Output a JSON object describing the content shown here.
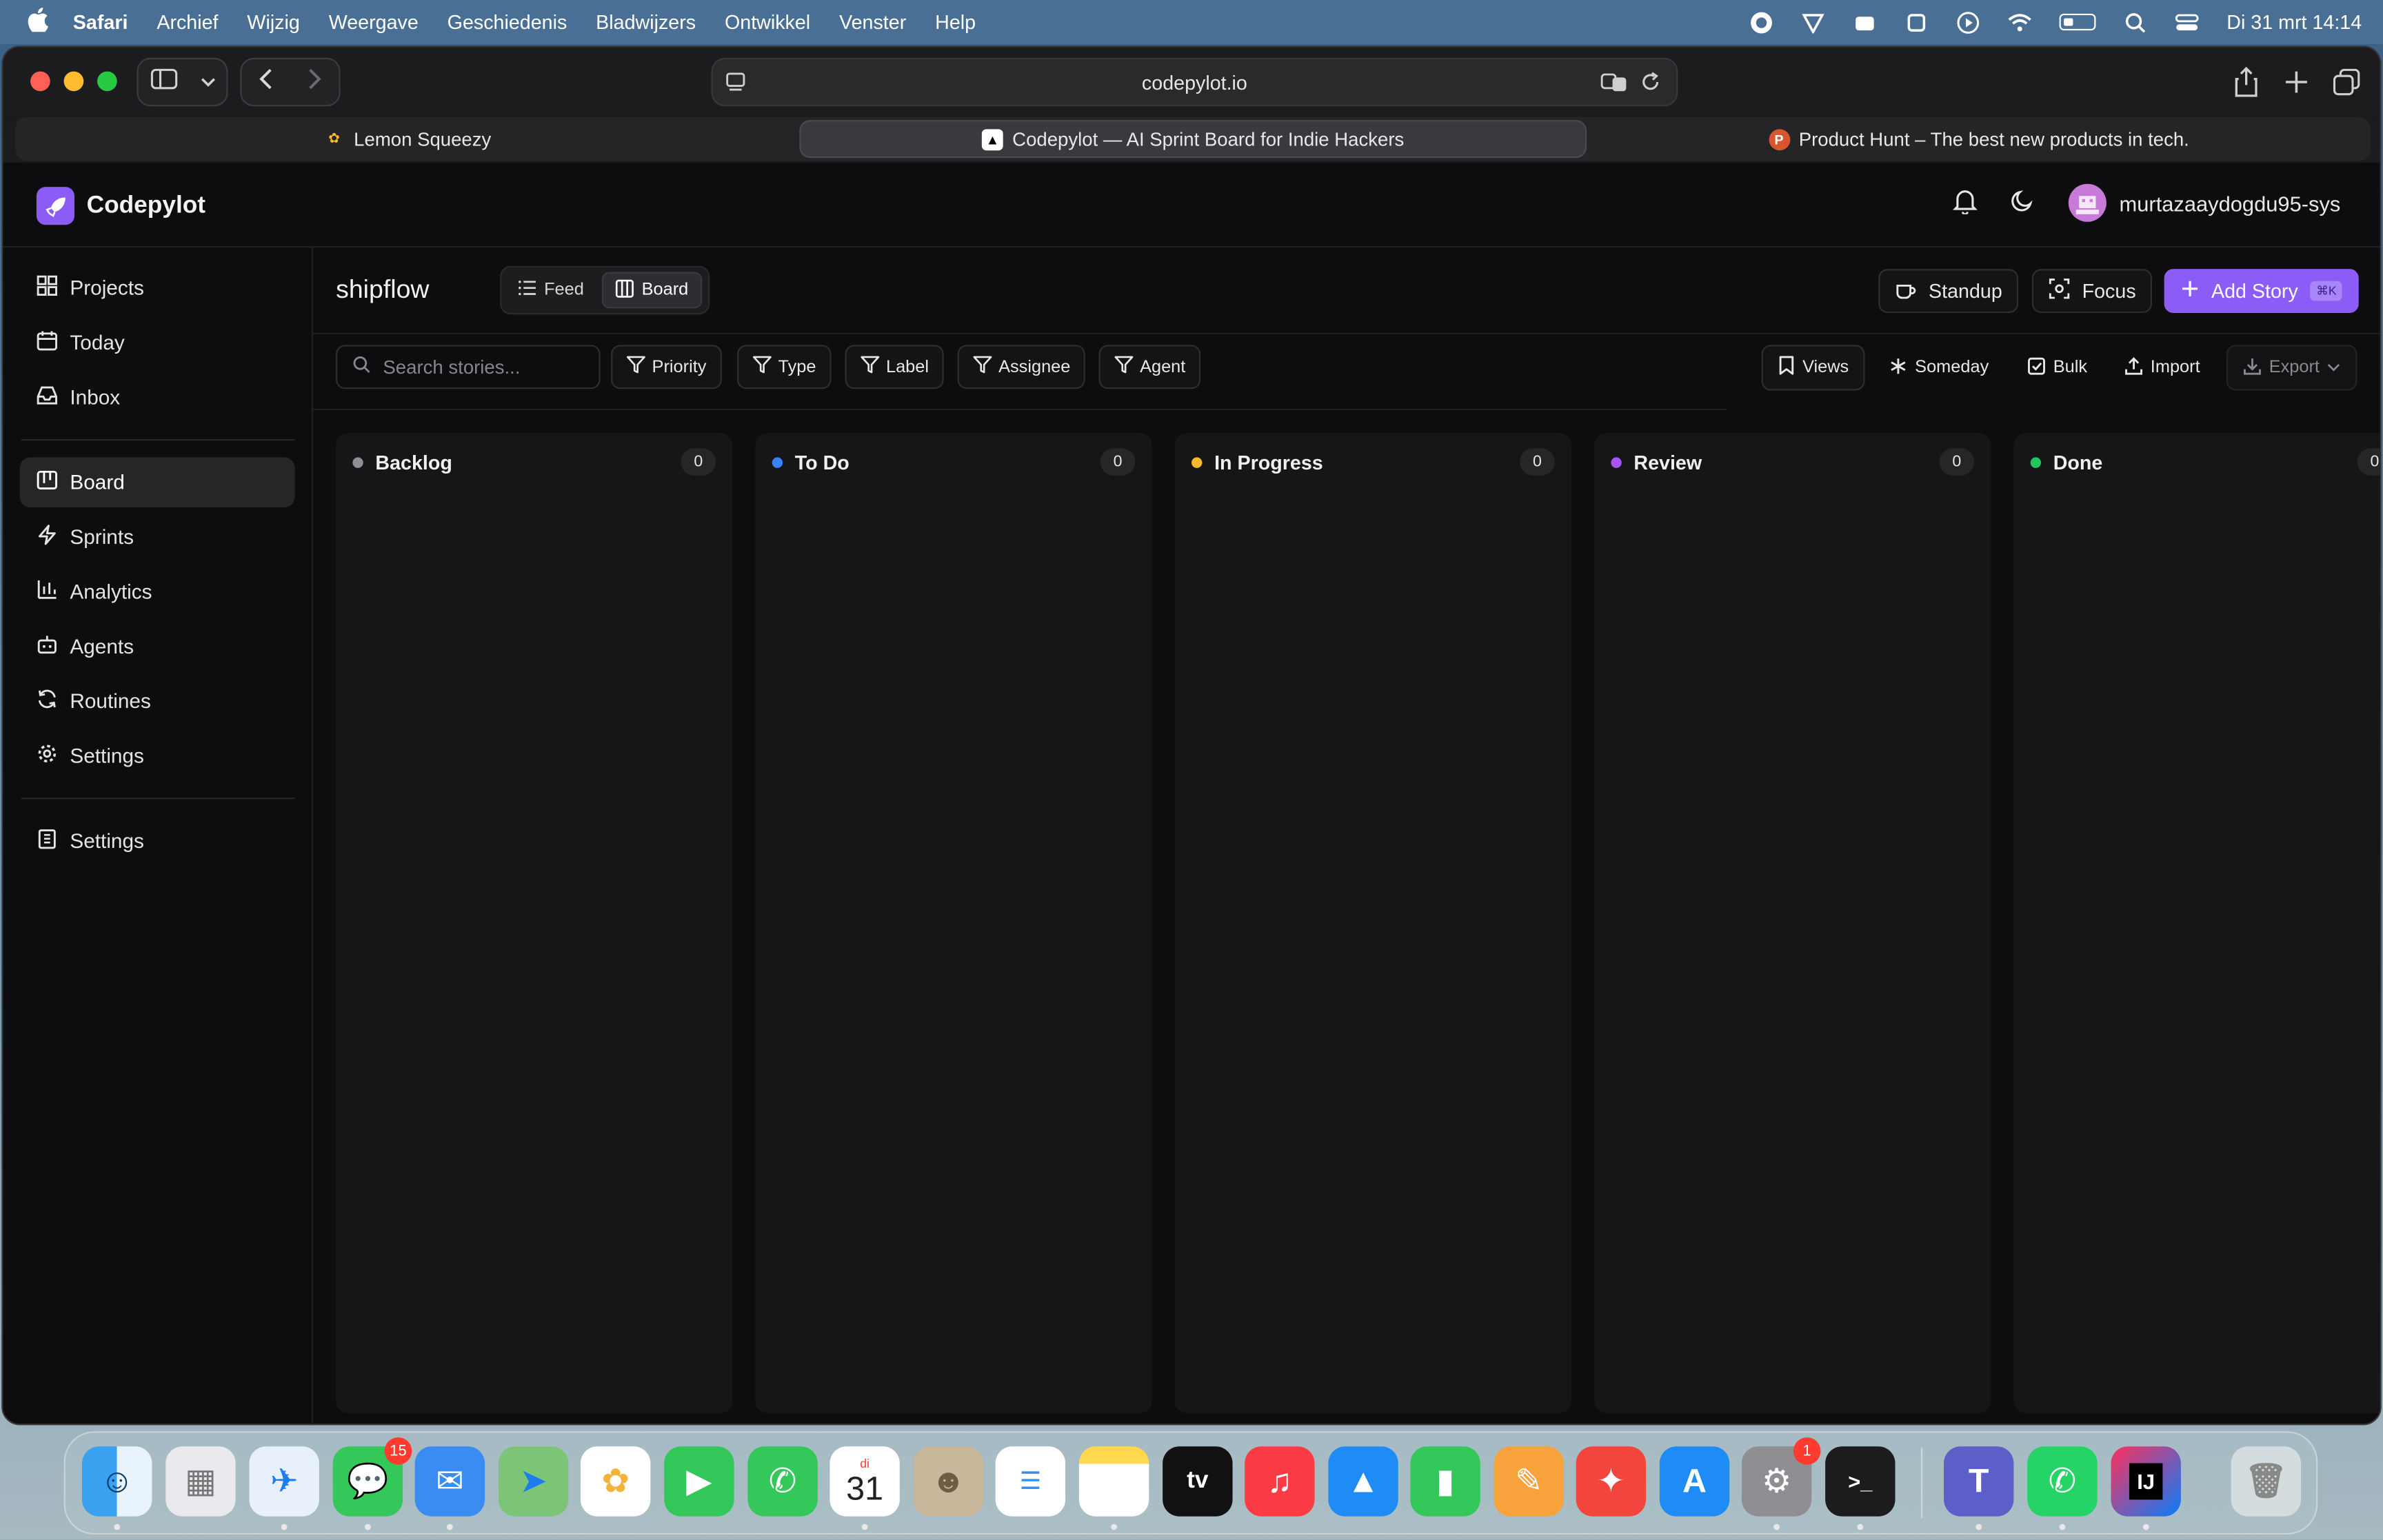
{
  "menubar": {
    "app": "Safari",
    "items": [
      "Archief",
      "Wijzig",
      "Weergave",
      "Geschiedenis",
      "Bladwijzers",
      "Ontwikkel",
      "Venster",
      "Help"
    ],
    "datetime": "Di 31 mrt  14:14"
  },
  "browser": {
    "url": "codepylot.io",
    "tabs": [
      {
        "label": "Lemon Squeezy",
        "active": false
      },
      {
        "label": "Codepylot — AI Sprint Board for Indie Hackers",
        "active": true
      },
      {
        "label": "Product Hunt – The best new products in tech.",
        "active": false
      }
    ]
  },
  "app": {
    "brand": "Codepylot",
    "username": "murtazaaydogdu95-sys",
    "sidebar": {
      "group1": [
        {
          "label": "Projects",
          "icon": "grid-icon"
        },
        {
          "label": "Today",
          "icon": "calendar-icon"
        },
        {
          "label": "Inbox",
          "icon": "inbox-icon"
        }
      ],
      "group2": [
        {
          "label": "Board",
          "icon": "board-icon",
          "active": true
        },
        {
          "label": "Sprints",
          "icon": "bolt-icon"
        },
        {
          "label": "Analytics",
          "icon": "bar-chart-icon"
        },
        {
          "label": "Agents",
          "icon": "bot-icon"
        },
        {
          "label": "Routines",
          "icon": "refresh-icon"
        },
        {
          "label": "Settings",
          "icon": "gear-icon"
        }
      ],
      "group3": [
        {
          "label": "Settings",
          "icon": "building-icon"
        }
      ]
    },
    "project_name": "shipflow",
    "view_toggle": {
      "feed": "Feed",
      "board": "Board"
    },
    "header_buttons": {
      "standup": "Standup",
      "focus": "Focus",
      "add_story": "Add Story",
      "add_story_kbd": "⌘K"
    },
    "search_placeholder": "Search stories...",
    "filters": [
      "Priority",
      "Type",
      "Label",
      "Assignee",
      "Agent"
    ],
    "tools": {
      "views": "Views",
      "someday": "Someday",
      "bulk": "Bulk",
      "import": "Import",
      "export": "Export"
    },
    "columns": [
      {
        "name": "Backlog",
        "count": "0",
        "color": "#8e8e93"
      },
      {
        "name": "To Do",
        "count": "0",
        "color": "#3b82f6"
      },
      {
        "name": "In Progress",
        "count": "0",
        "color": "#f5b82e"
      },
      {
        "name": "Review",
        "count": "0",
        "color": "#a855f7"
      },
      {
        "name": "Done",
        "count": "0",
        "color": "#22c55e"
      }
    ]
  },
  "dock": {
    "badges": {
      "messages": "15",
      "settings": "1"
    },
    "calendar_day": "31",
    "calendar_weekday": "di"
  },
  "colors": {
    "accent": "#8b5cf6",
    "background": "#0d0d0f"
  }
}
